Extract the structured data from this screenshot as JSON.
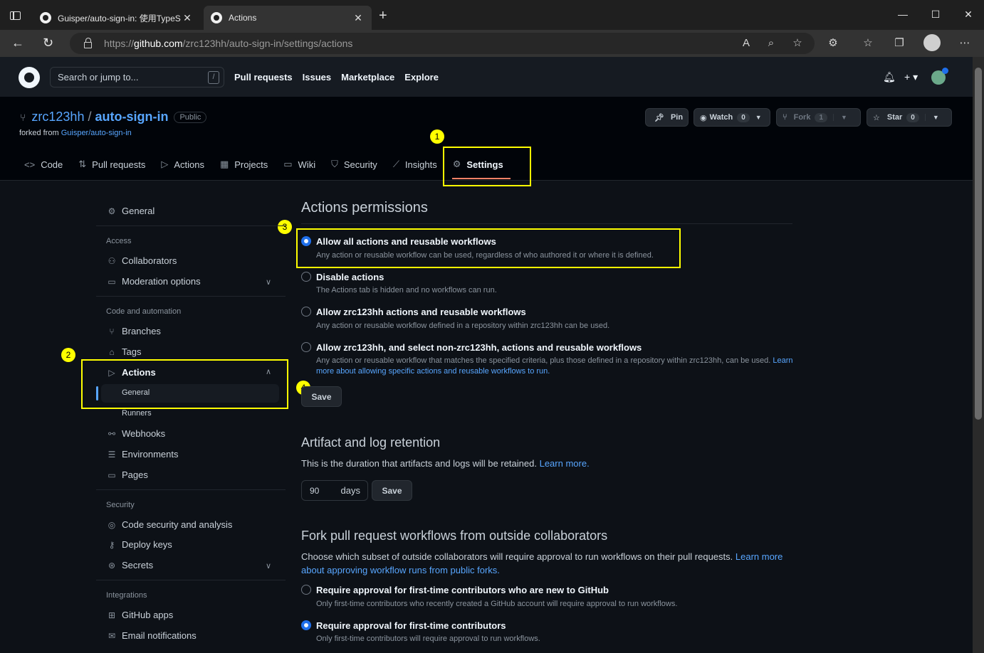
{
  "browser": {
    "tabs": [
      {
        "title": "Guisper/auto-sign-in: 使用TypeS",
        "active": false
      },
      {
        "title": "Actions",
        "active": true
      }
    ],
    "url_prefix": "https://",
    "url_host": "github.com",
    "url_path": "/zrc123hh/auto-sign-in/settings/actions"
  },
  "header": {
    "search_placeholder": "Search or jump to...",
    "search_shortcut": "/",
    "nav": [
      "Pull requests",
      "Issues",
      "Marketplace",
      "Explore"
    ]
  },
  "repo": {
    "owner": "zrc123hh",
    "name": "auto-sign-in",
    "visibility": "Public",
    "forked_from_label": "forked from",
    "forked_from": "Guisper/auto-sign-in",
    "buttons": {
      "pin": "Pin",
      "watch": "Watch",
      "watch_count": "0",
      "fork": "Fork",
      "fork_count": "1",
      "star": "Star",
      "star_count": "0"
    },
    "tabs": [
      {
        "label": "Code",
        "icon": "code-icon"
      },
      {
        "label": "Pull requests",
        "icon": "pull-request-icon"
      },
      {
        "label": "Actions",
        "icon": "play-icon"
      },
      {
        "label": "Projects",
        "icon": "table-icon"
      },
      {
        "label": "Wiki",
        "icon": "book-icon"
      },
      {
        "label": "Security",
        "icon": "shield-icon"
      },
      {
        "label": "Insights",
        "icon": "graph-icon"
      },
      {
        "label": "Settings",
        "icon": "gear-icon"
      }
    ]
  },
  "markers": [
    "1",
    "2",
    "3",
    "4"
  ],
  "sidebar": {
    "general": "General",
    "access_heading": "Access",
    "collaborators": "Collaborators",
    "moderation": "Moderation options",
    "code_heading": "Code and automation",
    "branches": "Branches",
    "tags": "Tags",
    "actions": "Actions",
    "actions_general": "General",
    "actions_runners": "Runners",
    "webhooks": "Webhooks",
    "environments": "Environments",
    "pages": "Pages",
    "security_heading": "Security",
    "code_security": "Code security and analysis",
    "deploy_keys": "Deploy keys",
    "secrets": "Secrets",
    "integrations_heading": "Integrations",
    "github_apps": "GitHub apps",
    "email_notifications": "Email notifications"
  },
  "main": {
    "permissions_title": "Actions permissions",
    "options": [
      {
        "title": "Allow all actions and reusable workflows",
        "desc": "Any action or reusable workflow can be used, regardless of who authored it or where it is defined.",
        "checked": true
      },
      {
        "title": "Disable actions",
        "desc": "The Actions tab is hidden and no workflows can run.",
        "checked": false
      },
      {
        "title": "Allow zrc123hh actions and reusable workflows",
        "desc": "Any action or reusable workflow defined in a repository within zrc123hh can be used.",
        "checked": false
      },
      {
        "title": "Allow zrc123hh, and select non-zrc123hh, actions and reusable workflows",
        "desc": "Any action or reusable workflow that matches the specified criteria, plus those defined in a repository within zrc123hh, can be used.",
        "desc_link_1": "Learn",
        "desc_link_2": "more about allowing specific actions and reusable workflows to run.",
        "checked": false
      }
    ],
    "save_label": "Save",
    "retention_title": "Artifact and log retention",
    "retention_desc": "This is the duration that artifacts and logs will be retained.",
    "retention_link": "Learn more.",
    "retention_value": "90",
    "retention_unit": "days",
    "retention_save": "Save",
    "fork_title": "Fork pull request workflows from outside collaborators",
    "fork_desc": "Choose which subset of outside collaborators will require approval to run workflows on their pull requests.",
    "fork_link_1": "Learn more",
    "fork_link_2": "about approving workflow runs from public forks.",
    "fork_options": [
      {
        "title": "Require approval for first-time contributors who are new to GitHub",
        "desc": "Only first-time contributors who recently created a GitHub account will require approval to run workflows.",
        "checked": false
      },
      {
        "title": "Require approval for first-time contributors",
        "desc": "Only first-time contributors will require approval to run workflows.",
        "checked": true
      }
    ]
  },
  "colors": {
    "highlight": "#ffff00",
    "link": "#58a6ff",
    "radio_checked": "#1f6feb",
    "tab_underline": "#f78166"
  }
}
